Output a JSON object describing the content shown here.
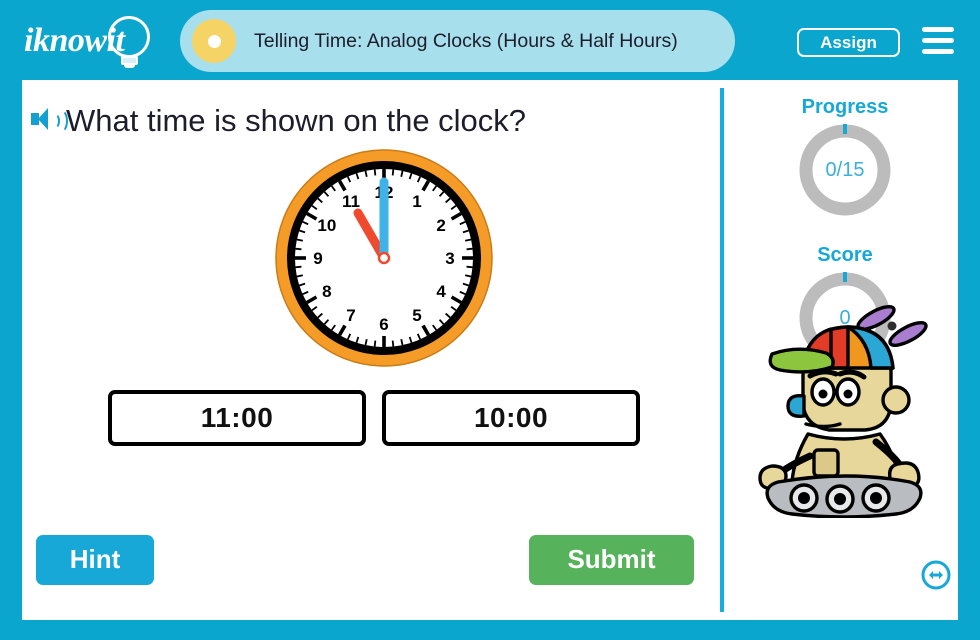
{
  "header": {
    "logo_text": "iknowit",
    "logo_icon": "lightbulb-icon",
    "title": "Telling Time: Analog Clocks (Hours & Half Hours)",
    "title_icon": "yellow-dot-icon",
    "assign_label": "Assign",
    "menu_icon": "hamburger-menu-icon"
  },
  "question": {
    "audio_icon": "speaker-icon",
    "text": "What time is shown on the clock?"
  },
  "clock": {
    "displayed_time": "11:00",
    "hour_hand_value": 11,
    "minute_hand_value": 0,
    "hour_hand_color": "#ef4a2e",
    "minute_hand_color": "#3eb3e8",
    "bezel_color": "#f59b28",
    "rim_color": "#000000",
    "face_color": "#ffffff",
    "numerals": [
      "12",
      "1",
      "2",
      "3",
      "4",
      "5",
      "6",
      "7",
      "8",
      "9",
      "10",
      "11"
    ]
  },
  "answers": [
    {
      "label": "11:00"
    },
    {
      "label": "10:00"
    }
  ],
  "actions": {
    "hint_label": "Hint",
    "submit_label": "Submit",
    "hint_color": "#17a8d8",
    "submit_color": "#57b25c"
  },
  "sidebar": {
    "progress": {
      "label": "Progress",
      "value": "0/15",
      "completed": 0,
      "total": 15
    },
    "score": {
      "label": "Score",
      "value": "0"
    },
    "ring_track_color": "#bcbcbc",
    "ring_tick_color": "#17a8d8",
    "accent_color": "#17a8d8",
    "mascot_icon": "robot-mascot",
    "resize_icon": "left-right-arrows-icon"
  },
  "theme": {
    "frame_color": "#0aa6ce",
    "divider_color": "#17aedd",
    "title_pill_color": "#a8dfec"
  }
}
